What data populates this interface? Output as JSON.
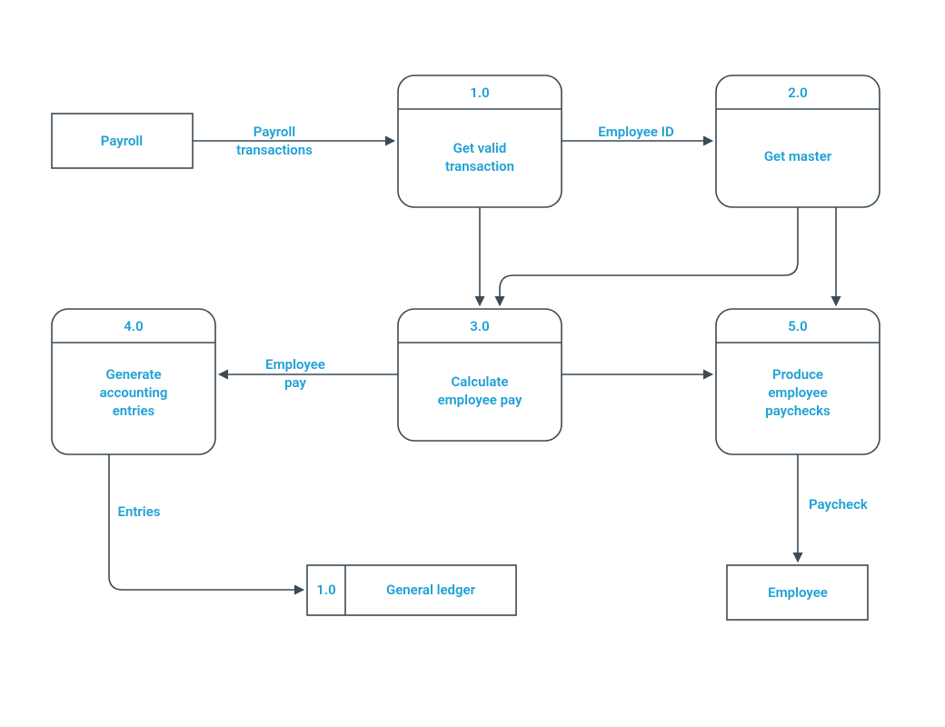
{
  "entities": {
    "payroll": "Payroll",
    "employee": "Employee"
  },
  "datastore": {
    "ledger_id": "1.0",
    "ledger_name": "General ledger"
  },
  "processes": {
    "p1": {
      "id": "1.0",
      "name_l1": "Get valid",
      "name_l2": "transaction"
    },
    "p2": {
      "id": "2.0",
      "name_l1": "Get master",
      "name_l2": ""
    },
    "p3": {
      "id": "3.0",
      "name_l1": "Calculate",
      "name_l2": "employee pay"
    },
    "p4": {
      "id": "4.0",
      "name_l1": "Generate",
      "name_l2": "accounting",
      "name_l3": "entries"
    },
    "p5": {
      "id": "5.0",
      "name_l1": "Produce",
      "name_l2": "employee",
      "name_l3": "paychecks"
    }
  },
  "flows": {
    "payroll_tx_l1": "Payroll",
    "payroll_tx_l2": "transactions",
    "employee_id": "Employee ID",
    "employee_pay_l1": "Employee",
    "employee_pay_l2": "pay",
    "entries": "Entries",
    "paycheck": "Paycheck"
  }
}
